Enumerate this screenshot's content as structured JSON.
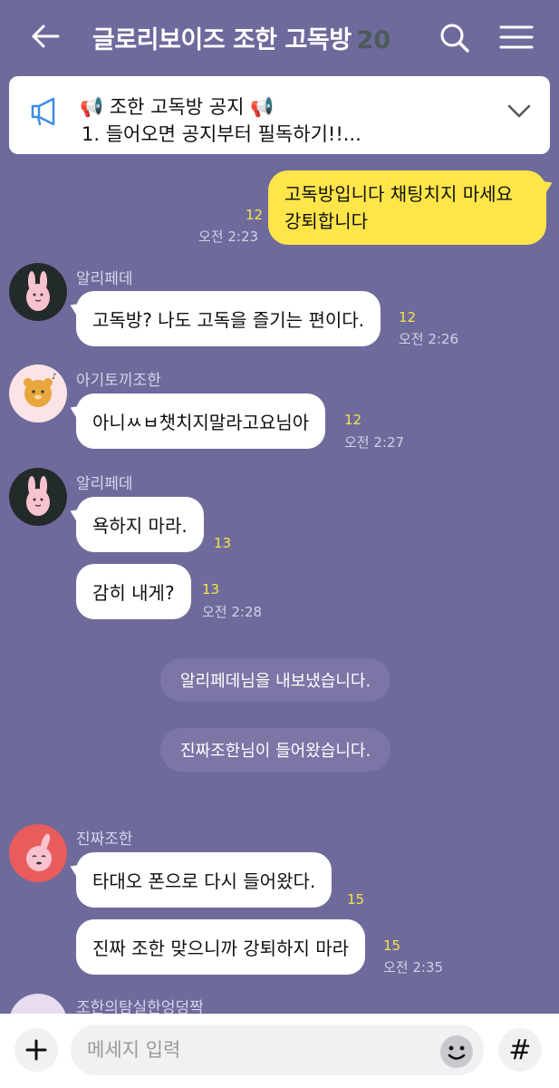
{
  "header": {
    "title": "글로리보이즈 조한 고독방",
    "member_count": "20"
  },
  "notice": {
    "title": "📢 조한 고독방 공지 📢",
    "body": "1. 들어오면 공지부터 필독하기!!..."
  },
  "messages": [
    {
      "text_line1": "고독방입니다 채팅치지 마세요",
      "text_line2": "강퇴합니다",
      "count": "12",
      "time": "오전 2:23"
    },
    {
      "sender": "알리페데",
      "text": "고독방? 나도 고독을 즐기는 편이다.",
      "count": "12",
      "time": "오전 2:26"
    },
    {
      "sender": "아기토끼조한",
      "text": "아니ㅆㅂ챗치지말라고요님아",
      "count": "12",
      "time": "오전 2:27"
    },
    {
      "sender": "알리페데",
      "text": "욕하지 마라.",
      "count": "13"
    },
    {
      "text": "감히 내게?",
      "count": "13",
      "time": "오전 2:28"
    },
    {
      "sender": "진짜조한",
      "text": "타대오 폰으로 다시 들어왔다.",
      "count": "15"
    },
    {
      "text": "진짜 조한 맞으니까 강퇴하지 마라",
      "count": "15",
      "time": "오전 2:35"
    },
    {
      "sender": "조한의탐실한엉덩짝"
    }
  ],
  "system_messages": [
    "알리페데님을 내보냈습니다.",
    "진짜조한님이 들어왔습니다."
  ],
  "input": {
    "placeholder": "메세지 입력",
    "hash_label": "#"
  },
  "colors": {
    "background": "#6f6a9c",
    "my_bubble": "#fde54a",
    "read_count": "#f7e447"
  }
}
